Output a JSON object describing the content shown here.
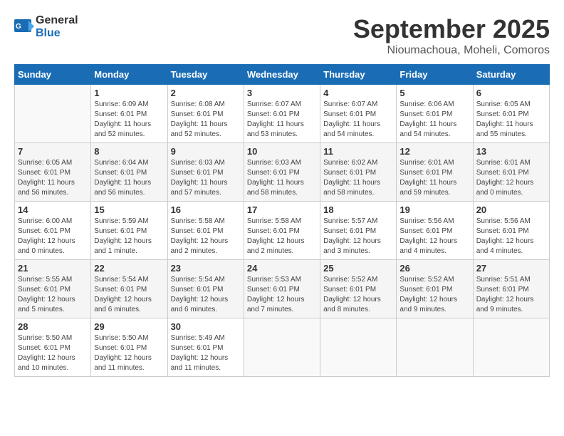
{
  "logo": {
    "general": "General",
    "blue": "Blue"
  },
  "title": "September 2025",
  "subtitle": "Nioumachoua, Moheli, Comoros",
  "weekdays": [
    "Sunday",
    "Monday",
    "Tuesday",
    "Wednesday",
    "Thursday",
    "Friday",
    "Saturday"
  ],
  "weeks": [
    [
      {
        "day": "",
        "detail": ""
      },
      {
        "day": "1",
        "detail": "Sunrise: 6:09 AM\nSunset: 6:01 PM\nDaylight: 11 hours\nand 52 minutes."
      },
      {
        "day": "2",
        "detail": "Sunrise: 6:08 AM\nSunset: 6:01 PM\nDaylight: 11 hours\nand 52 minutes."
      },
      {
        "day": "3",
        "detail": "Sunrise: 6:07 AM\nSunset: 6:01 PM\nDaylight: 11 hours\nand 53 minutes."
      },
      {
        "day": "4",
        "detail": "Sunrise: 6:07 AM\nSunset: 6:01 PM\nDaylight: 11 hours\nand 54 minutes."
      },
      {
        "day": "5",
        "detail": "Sunrise: 6:06 AM\nSunset: 6:01 PM\nDaylight: 11 hours\nand 54 minutes."
      },
      {
        "day": "6",
        "detail": "Sunrise: 6:05 AM\nSunset: 6:01 PM\nDaylight: 11 hours\nand 55 minutes."
      }
    ],
    [
      {
        "day": "7",
        "detail": "Sunrise: 6:05 AM\nSunset: 6:01 PM\nDaylight: 11 hours\nand 56 minutes."
      },
      {
        "day": "8",
        "detail": "Sunrise: 6:04 AM\nSunset: 6:01 PM\nDaylight: 11 hours\nand 56 minutes."
      },
      {
        "day": "9",
        "detail": "Sunrise: 6:03 AM\nSunset: 6:01 PM\nDaylight: 11 hours\nand 57 minutes."
      },
      {
        "day": "10",
        "detail": "Sunrise: 6:03 AM\nSunset: 6:01 PM\nDaylight: 11 hours\nand 58 minutes."
      },
      {
        "day": "11",
        "detail": "Sunrise: 6:02 AM\nSunset: 6:01 PM\nDaylight: 11 hours\nand 58 minutes."
      },
      {
        "day": "12",
        "detail": "Sunrise: 6:01 AM\nSunset: 6:01 PM\nDaylight: 11 hours\nand 59 minutes."
      },
      {
        "day": "13",
        "detail": "Sunrise: 6:01 AM\nSunset: 6:01 PM\nDaylight: 12 hours\nand 0 minutes."
      }
    ],
    [
      {
        "day": "14",
        "detail": "Sunrise: 6:00 AM\nSunset: 6:01 PM\nDaylight: 12 hours\nand 0 minutes."
      },
      {
        "day": "15",
        "detail": "Sunrise: 5:59 AM\nSunset: 6:01 PM\nDaylight: 12 hours\nand 1 minute."
      },
      {
        "day": "16",
        "detail": "Sunrise: 5:58 AM\nSunset: 6:01 PM\nDaylight: 12 hours\nand 2 minutes."
      },
      {
        "day": "17",
        "detail": "Sunrise: 5:58 AM\nSunset: 6:01 PM\nDaylight: 12 hours\nand 2 minutes."
      },
      {
        "day": "18",
        "detail": "Sunrise: 5:57 AM\nSunset: 6:01 PM\nDaylight: 12 hours\nand 3 minutes."
      },
      {
        "day": "19",
        "detail": "Sunrise: 5:56 AM\nSunset: 6:01 PM\nDaylight: 12 hours\nand 4 minutes."
      },
      {
        "day": "20",
        "detail": "Sunrise: 5:56 AM\nSunset: 6:01 PM\nDaylight: 12 hours\nand 4 minutes."
      }
    ],
    [
      {
        "day": "21",
        "detail": "Sunrise: 5:55 AM\nSunset: 6:01 PM\nDaylight: 12 hours\nand 5 minutes."
      },
      {
        "day": "22",
        "detail": "Sunrise: 5:54 AM\nSunset: 6:01 PM\nDaylight: 12 hours\nand 6 minutes."
      },
      {
        "day": "23",
        "detail": "Sunrise: 5:54 AM\nSunset: 6:01 PM\nDaylight: 12 hours\nand 6 minutes."
      },
      {
        "day": "24",
        "detail": "Sunrise: 5:53 AM\nSunset: 6:01 PM\nDaylight: 12 hours\nand 7 minutes."
      },
      {
        "day": "25",
        "detail": "Sunrise: 5:52 AM\nSunset: 6:01 PM\nDaylight: 12 hours\nand 8 minutes."
      },
      {
        "day": "26",
        "detail": "Sunrise: 5:52 AM\nSunset: 6:01 PM\nDaylight: 12 hours\nand 9 minutes."
      },
      {
        "day": "27",
        "detail": "Sunrise: 5:51 AM\nSunset: 6:01 PM\nDaylight: 12 hours\nand 9 minutes."
      }
    ],
    [
      {
        "day": "28",
        "detail": "Sunrise: 5:50 AM\nSunset: 6:01 PM\nDaylight: 12 hours\nand 10 minutes."
      },
      {
        "day": "29",
        "detail": "Sunrise: 5:50 AM\nSunset: 6:01 PM\nDaylight: 12 hours\nand 11 minutes."
      },
      {
        "day": "30",
        "detail": "Sunrise: 5:49 AM\nSunset: 6:01 PM\nDaylight: 12 hours\nand 11 minutes."
      },
      {
        "day": "",
        "detail": ""
      },
      {
        "day": "",
        "detail": ""
      },
      {
        "day": "",
        "detail": ""
      },
      {
        "day": "",
        "detail": ""
      }
    ]
  ]
}
